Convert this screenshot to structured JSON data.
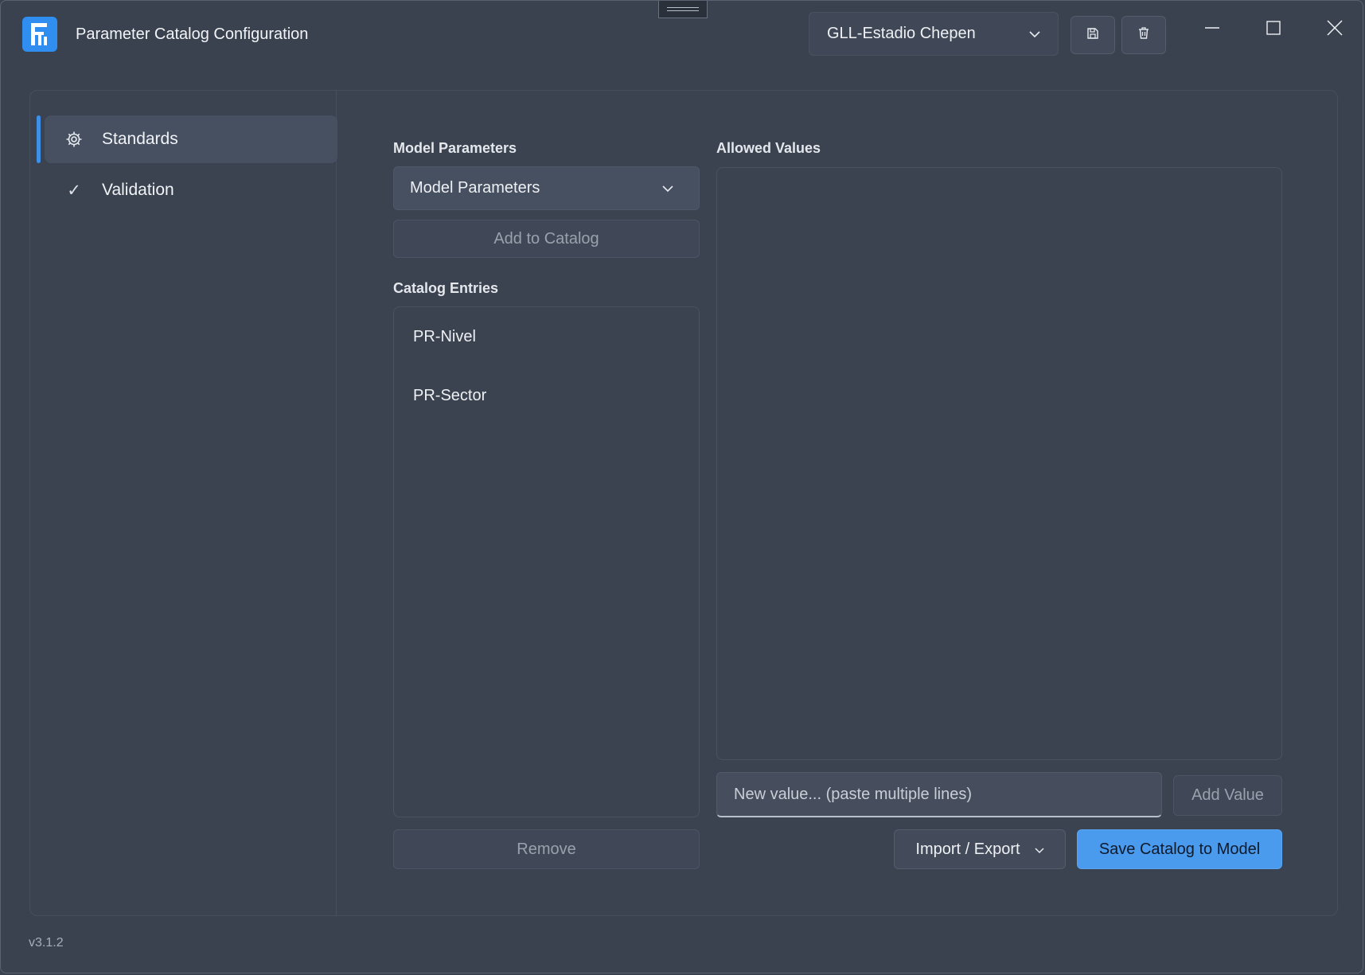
{
  "window": {
    "title": "Parameter Catalog Configuration",
    "project": "GLL-Estadio Chepen",
    "version": "v3.1.2"
  },
  "sidebar": {
    "items": [
      {
        "label": "Standards",
        "icon": "gear-icon",
        "active": true
      },
      {
        "label": "Validation",
        "icon": "check-icon",
        "active": false
      }
    ]
  },
  "model_parameters": {
    "heading": "Model Parameters",
    "dropdown_value": "Model Parameters",
    "add_button": "Add to Catalog"
  },
  "catalog_entries": {
    "heading": "Catalog Entries",
    "items": [
      "PR-Nivel",
      "PR-Sector"
    ],
    "remove_button": "Remove"
  },
  "allowed_values": {
    "heading": "Allowed Values",
    "input_placeholder": "New value... (paste multiple lines)",
    "add_button": "Add Value"
  },
  "footer_actions": {
    "import_export": "Import / Export",
    "save": "Save Catalog to Model"
  },
  "colors": {
    "accent": "#3d8fe8",
    "primary_button": "#4a9aee",
    "background": "#3a4250"
  }
}
